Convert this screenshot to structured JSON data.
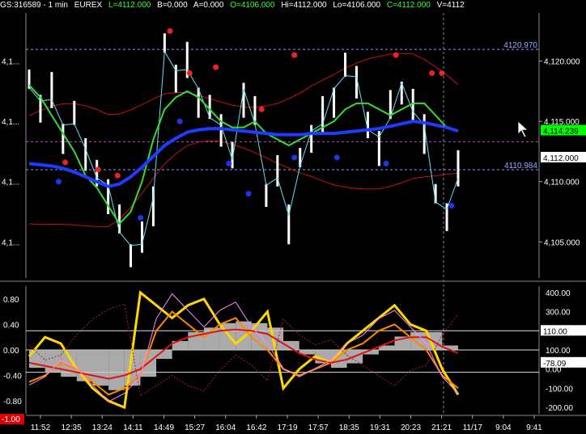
{
  "header": {
    "symbol": "GS:316589 - 1 min",
    "exchange": "EUREX",
    "last": "L=4112.000",
    "bid": "B=0.000",
    "ask": "A=0.000",
    "open": "O=4106.000",
    "high": "Hi=4112.000",
    "low": "Lo=4106.000",
    "close": "C=4112.000",
    "volume": "V=4112"
  },
  "colors": {
    "background": "#000000",
    "price_bar": "#ffffff",
    "close_line": "#66e0f0",
    "moving_avg_fast": "#33dd33",
    "moving_avg_slow": "#1e3cff",
    "band": "#cc1111",
    "pivot_high": "#ee2222",
    "pivot_low": "#2233ee",
    "osc_yellow": "#ffd700",
    "osc_orange": "#ff8800",
    "osc_histogram": "#c8c8c8",
    "accent_green": "#00ff00"
  },
  "chart_data": [
    {
      "type": "line",
      "panel": "price",
      "x_ticks": [
        "11:52",
        "12:35",
        "13:24",
        "14:11",
        "14:49",
        "15:27",
        "16:04",
        "16:42",
        "17:19",
        "17:57",
        "18:35",
        "19:31",
        "20:23",
        "21:21",
        "11/17",
        "9:04",
        "9:41"
      ],
      "right_axis_ticks": [
        "4,120.000",
        "4,115.000",
        "4,110.000",
        "4,105.000"
      ],
      "left_axis_ticks": [
        "4,1...",
        "4,1...",
        "4,1...",
        "4,1..."
      ],
      "ylim": [
        4102,
        4124
      ],
      "reference_lines": [
        {
          "label": "4120.970",
          "value": 4120.97
        },
        {
          "label": "4110.984",
          "value": 4110.984
        }
      ],
      "price_tags": [
        {
          "label": "4,114.239",
          "value": 4114.239,
          "color": "#00ff00"
        },
        {
          "label": "4,112.000",
          "value": 4112.0,
          "color": "#ffffff"
        }
      ],
      "series": [
        {
          "name": "",
          "values": [
            4118.5,
            4116.0,
            4117.5,
            4114.0,
            4115.5,
            4112.0,
            4111.0,
            4109.0,
            4106.5,
            4104.0,
            4105.5,
            4108.0,
            4121.5,
            4118.5,
            4120.0,
            4117.0,
            4116.0,
            4114.0,
            4112.5,
            4117.0,
            4115.5,
            4109.0,
            4111.0,
            4106.5,
            4112.0,
            4113.5,
            4115.5,
            4117.0,
            4119.5,
            4118.0,
            4115.0,
            4113.0,
            4116.0,
            4117.5,
            4116.5,
            4114.0,
            4109.0,
            4107.0,
            4111.0
          ]
        },
        {
          "name": "",
          "values": [
            4111.5,
            4111.4,
            4111.3,
            4111.1,
            4110.8,
            4110.4,
            4110.0,
            4109.6,
            4109.8,
            4110.4,
            4111.2,
            4112.1,
            4113.0,
            4113.6,
            4114.1,
            4114.3,
            4114.4,
            4114.4,
            4114.3,
            4114.2,
            4114.1,
            4114.0,
            4113.9,
            4113.9,
            4113.9,
            4114.0,
            4114.0,
            4114.0,
            4114.1,
            4114.2,
            4114.3,
            4114.4,
            4114.6,
            4114.8,
            4115.0,
            4114.9,
            4114.7,
            4114.5,
            4114.2
          ]
        },
        {
          "name": "",
          "values": [
            4118.0,
            4117.0,
            4115.5,
            4114.0,
            4112.5,
            4110.5,
            4109.5,
            4108.0,
            4106.5,
            4107.5,
            4110.0,
            4113.5,
            4116.0,
            4117.0,
            4117.5,
            4117.0,
            4116.0,
            4115.0,
            4114.5,
            4114.5,
            4115.0,
            4114.0,
            4113.5,
            4113.0,
            4113.5,
            4114.0,
            4114.5,
            4115.0,
            4116.0,
            4116.5,
            4116.5,
            4116.0,
            4115.5,
            4116.0,
            4116.5,
            4116.5,
            4115.5,
            4114.5,
            4114.2
          ]
        }
      ]
    },
    {
      "type": "line",
      "panel": "oscillator",
      "left_axis_ticks": [
        "0.80",
        "0.40",
        "0.00",
        "-0.40",
        "-0.80"
      ],
      "left_marker": "-1.00",
      "right_axis_ticks": [
        "400.00",
        "300.00",
        "200.00",
        "100.00",
        "0.00",
        "-100.00",
        "-200.00"
      ],
      "ylim": [
        -1.0,
        1.0
      ],
      "price_tags": [
        {
          "label": "110.00",
          "value": 0.3
        },
        {
          "label": "-78.09",
          "value": -0.2
        }
      ],
      "series": [
        {
          "name": "",
          "values": [
            -0.1,
            0.2,
            0.1,
            -0.3,
            -0.6,
            -0.8,
            -0.9,
            0.9,
            0.7,
            0.5,
            0.7,
            0.8,
            0.4,
            0.1,
            0.3,
            0.6,
            -0.6,
            -0.3,
            -0.1,
            -0.2,
            0.1,
            0.3,
            0.5,
            0.7,
            0.4,
            0.3,
            -0.3,
            -0.7
          ]
        },
        {
          "name": "",
          "values": [
            -0.5,
            -0.4,
            -0.2,
            -0.3,
            -0.5,
            -0.7,
            -0.6,
            -0.4,
            0.3,
            0.6,
            0.4,
            0.2,
            0.4,
            0.5,
            0.2,
            0.0,
            -0.3,
            -0.4,
            -0.3,
            -0.2,
            0.0,
            0.1,
            0.3,
            0.4,
            0.2,
            0.0,
            -0.4,
            -0.6
          ]
        },
        {
          "name": "",
          "values": [
            -0.2,
            -0.25,
            -0.3,
            -0.35,
            -0.4,
            -0.45,
            -0.4,
            -0.3,
            -0.1,
            0.1,
            0.2,
            0.25,
            0.3,
            0.32,
            0.3,
            0.25,
            0.1,
            -0.05,
            -0.15,
            -0.2,
            -0.15,
            -0.05,
            0.05,
            0.15,
            0.2,
            0.2,
            0.05,
            -0.05
          ]
        }
      ]
    }
  ],
  "pivots": {
    "highs": [
      [
        0.12,
        4111.6
      ],
      [
        0.22,
        4111.0
      ],
      [
        0.28,
        4110.5
      ],
      [
        0.44,
        4122.5
      ],
      [
        0.5,
        4119.0
      ],
      [
        0.58,
        4119.5
      ],
      [
        0.72,
        4116.0
      ],
      [
        0.82,
        4120.5
      ],
      [
        1.13,
        4120.5
      ],
      [
        1.24,
        4119.0
      ],
      [
        1.27,
        4119.0
      ]
    ],
    "lows": [
      [
        0.1,
        4110.0
      ],
      [
        0.35,
        4107.0
      ],
      [
        0.47,
        4115.0
      ],
      [
        0.62,
        4111.5
      ],
      [
        0.68,
        4109.0
      ],
      [
        0.82,
        4112.0
      ],
      [
        0.95,
        4112.0
      ],
      [
        1.1,
        4111.5
      ],
      [
        1.3,
        4108.0
      ]
    ]
  }
}
